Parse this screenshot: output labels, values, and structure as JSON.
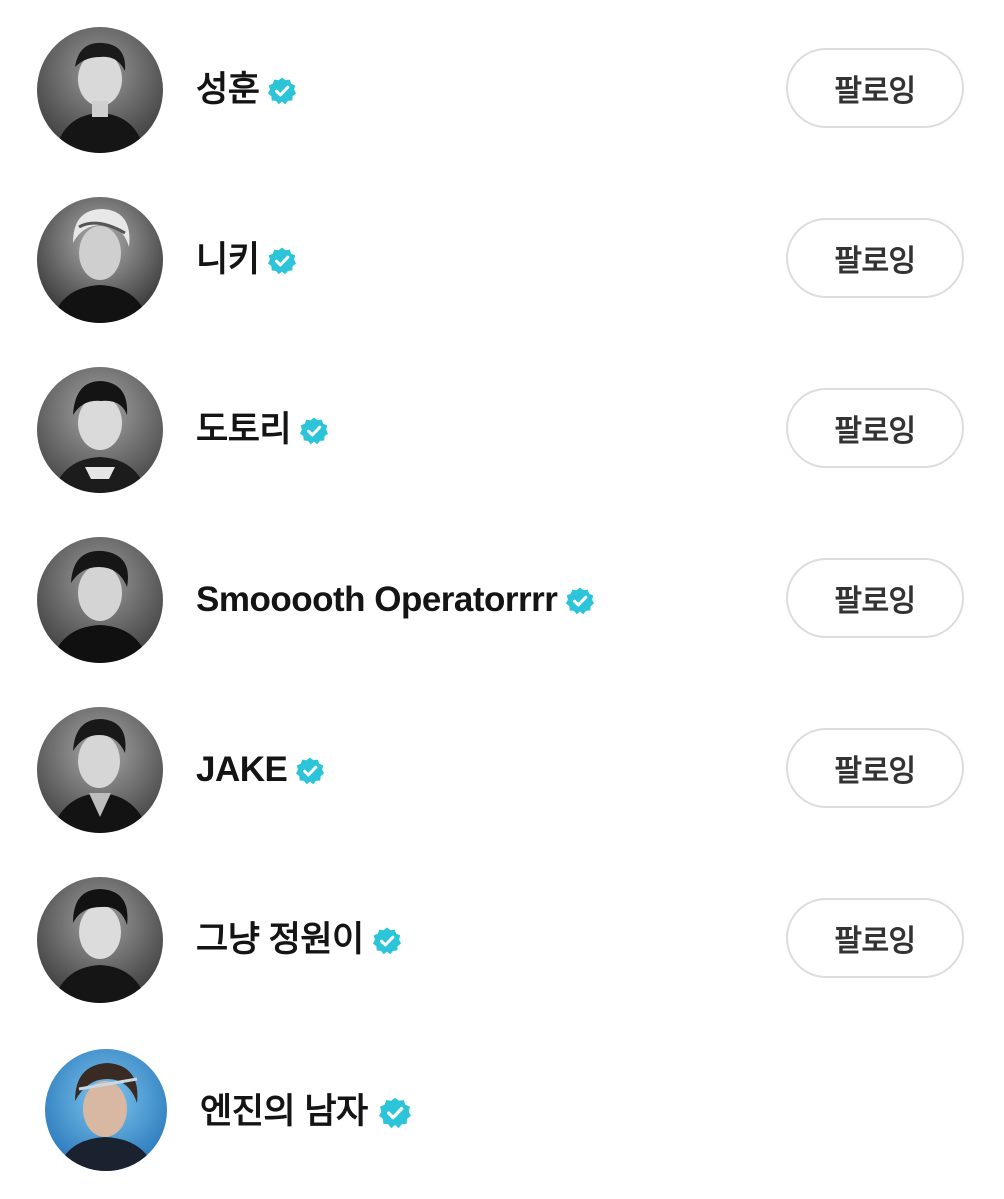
{
  "colors": {
    "verified_badge": "#2bc4d8",
    "button_border": "#dcdcdc",
    "button_text": "#333333",
    "name_text": "#141414"
  },
  "icons": {
    "verified": "verified-check-badge-icon"
  },
  "users": [
    {
      "name": "성훈",
      "button_label": "팔로잉",
      "avatar_tone": "mono"
    },
    {
      "name": "니키",
      "button_label": "팔로잉",
      "avatar_tone": "mono"
    },
    {
      "name": "도토리",
      "button_label": "팔로잉",
      "avatar_tone": "mono"
    },
    {
      "name": "Smooooth Operatorrrr",
      "button_label": "팔로잉",
      "avatar_tone": "mono"
    },
    {
      "name": "JAKE",
      "button_label": "팔로잉",
      "avatar_tone": "mono"
    },
    {
      "name": "그냥 정원이",
      "button_label": "팔로잉",
      "avatar_tone": "mono"
    },
    {
      "name": "엔진의 남자",
      "avatar_tone": "blue"
    }
  ]
}
